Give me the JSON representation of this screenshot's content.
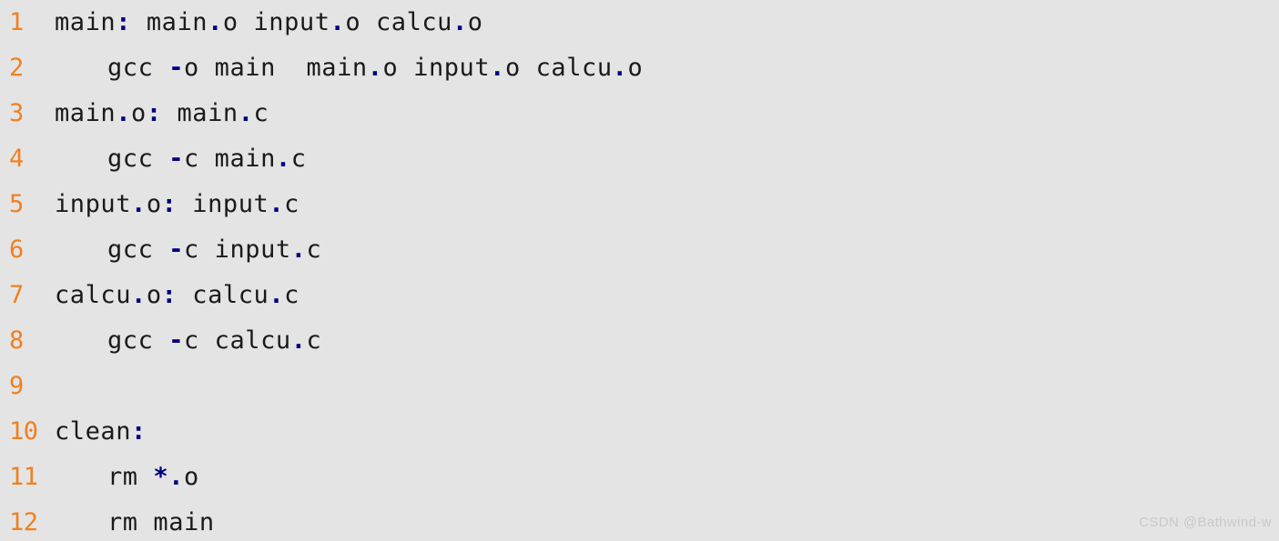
{
  "editor": {
    "background_color": "#E4E4E4",
    "line_number_color": "#F08020",
    "text_color": "#1A1A1A",
    "punctuation_color": "#000080",
    "language": "makefile",
    "line_count": 12
  },
  "lines": [
    {
      "number": "1",
      "text": "main: main.o input.o calcu.o",
      "indent": false,
      "tokens": [
        {
          "t": "main",
          "k": "text"
        },
        {
          "t": ":",
          "k": "punct"
        },
        {
          "t": " main",
          "k": "text"
        },
        {
          "t": ".",
          "k": "punct"
        },
        {
          "t": "o input",
          "k": "text"
        },
        {
          "t": ".",
          "k": "punct"
        },
        {
          "t": "o calcu",
          "k": "text"
        },
        {
          "t": ".",
          "k": "punct"
        },
        {
          "t": "o",
          "k": "text"
        }
      ]
    },
    {
      "number": "2",
      "text": "gcc -o main  main.o input.o calcu.o",
      "indent": true,
      "tokens": [
        {
          "t": "gcc ",
          "k": "text"
        },
        {
          "t": "-",
          "k": "punct"
        },
        {
          "t": "o main  main",
          "k": "text"
        },
        {
          "t": ".",
          "k": "punct"
        },
        {
          "t": "o input",
          "k": "text"
        },
        {
          "t": ".",
          "k": "punct"
        },
        {
          "t": "o calcu",
          "k": "text"
        },
        {
          "t": ".",
          "k": "punct"
        },
        {
          "t": "o",
          "k": "text"
        }
      ]
    },
    {
      "number": "3",
      "text": "main.o: main.c",
      "indent": false,
      "tokens": [
        {
          "t": "main",
          "k": "text"
        },
        {
          "t": ".",
          "k": "punct"
        },
        {
          "t": "o",
          "k": "text"
        },
        {
          "t": ":",
          "k": "punct"
        },
        {
          "t": " main",
          "k": "text"
        },
        {
          "t": ".",
          "k": "punct"
        },
        {
          "t": "c",
          "k": "text"
        }
      ]
    },
    {
      "number": "4",
      "text": "gcc -c main.c",
      "indent": true,
      "tokens": [
        {
          "t": "gcc ",
          "k": "text"
        },
        {
          "t": "-",
          "k": "punct"
        },
        {
          "t": "c main",
          "k": "text"
        },
        {
          "t": ".",
          "k": "punct"
        },
        {
          "t": "c",
          "k": "text"
        }
      ]
    },
    {
      "number": "5",
      "text": "input.o: input.c",
      "indent": false,
      "tokens": [
        {
          "t": "input",
          "k": "text"
        },
        {
          "t": ".",
          "k": "punct"
        },
        {
          "t": "o",
          "k": "text"
        },
        {
          "t": ":",
          "k": "punct"
        },
        {
          "t": " input",
          "k": "text"
        },
        {
          "t": ".",
          "k": "punct"
        },
        {
          "t": "c",
          "k": "text"
        }
      ]
    },
    {
      "number": "6",
      "text": "gcc -c input.c",
      "indent": true,
      "tokens": [
        {
          "t": "gcc ",
          "k": "text"
        },
        {
          "t": "-",
          "k": "punct"
        },
        {
          "t": "c input",
          "k": "text"
        },
        {
          "t": ".",
          "k": "punct"
        },
        {
          "t": "c",
          "k": "text"
        }
      ]
    },
    {
      "number": "7",
      "text": "calcu.o: calcu.c",
      "indent": false,
      "tokens": [
        {
          "t": "calcu",
          "k": "text"
        },
        {
          "t": ".",
          "k": "punct"
        },
        {
          "t": "o",
          "k": "text"
        },
        {
          "t": ":",
          "k": "punct"
        },
        {
          "t": " calcu",
          "k": "text"
        },
        {
          "t": ".",
          "k": "punct"
        },
        {
          "t": "c",
          "k": "text"
        }
      ]
    },
    {
      "number": "8",
      "text": "gcc -c calcu.c",
      "indent": true,
      "tokens": [
        {
          "t": "gcc ",
          "k": "text"
        },
        {
          "t": "-",
          "k": "punct"
        },
        {
          "t": "c calcu",
          "k": "text"
        },
        {
          "t": ".",
          "k": "punct"
        },
        {
          "t": "c",
          "k": "text"
        }
      ]
    },
    {
      "number": "9",
      "text": "",
      "indent": false,
      "tokens": []
    },
    {
      "number": "10",
      "text": "clean:",
      "indent": false,
      "tokens": [
        {
          "t": "clean",
          "k": "text"
        },
        {
          "t": ":",
          "k": "punct"
        }
      ]
    },
    {
      "number": "11",
      "text": "rm *.o",
      "indent": true,
      "tokens": [
        {
          "t": "rm ",
          "k": "text"
        },
        {
          "t": "*",
          "k": "punct"
        },
        {
          "t": ".",
          "k": "punct"
        },
        {
          "t": "o",
          "k": "text"
        }
      ]
    },
    {
      "number": "12",
      "text": "rm main",
      "indent": true,
      "tokens": [
        {
          "t": "rm main",
          "k": "text"
        }
      ]
    }
  ],
  "watermark": {
    "text": "CSDN @Bathwind-w",
    "color": "#C9C9C9"
  }
}
